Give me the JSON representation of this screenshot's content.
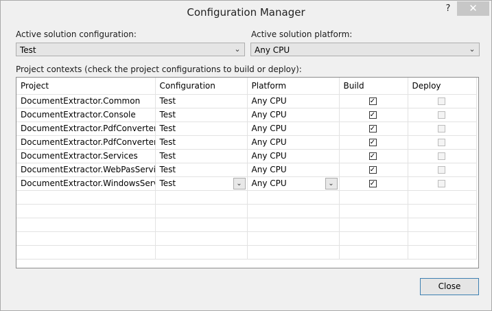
{
  "window": {
    "title": "Configuration Manager",
    "help": "?",
    "close_glyph": "✕"
  },
  "solution": {
    "config_label": "Active solution configuration:",
    "config_value": "Test",
    "platform_label": "Active solution platform:",
    "platform_value": "Any CPU"
  },
  "contexts_label": "Project contexts (check the project configurations to build or deploy):",
  "grid": {
    "columns": [
      "Project",
      "Configuration",
      "Platform",
      "Build",
      "Deploy"
    ],
    "rows": [
      {
        "project": "DocumentExtractor.Common",
        "configuration": "Test",
        "platform": "Any CPU",
        "build": true,
        "deploy": false
      },
      {
        "project": "DocumentExtractor.Console",
        "configuration": "Test",
        "platform": "Any CPU",
        "build": true,
        "deploy": false
      },
      {
        "project": "DocumentExtractor.PdfConverter",
        "configuration": "Test",
        "platform": "Any CPU",
        "build": true,
        "deploy": false
      },
      {
        "project": "DocumentExtractor.PdfConverter....",
        "configuration": "Test",
        "platform": "Any CPU",
        "build": true,
        "deploy": false
      },
      {
        "project": "DocumentExtractor.Services",
        "configuration": "Test",
        "platform": "Any CPU",
        "build": true,
        "deploy": false
      },
      {
        "project": "DocumentExtractor.WebPasServices",
        "configuration": "Test",
        "platform": "Any CPU",
        "build": true,
        "deploy": false
      },
      {
        "project": "DocumentExtractor.WindowsService",
        "configuration": "Test",
        "platform": "Any CPU",
        "build": true,
        "deploy": false
      }
    ]
  },
  "buttons": {
    "close_label": "Close"
  }
}
